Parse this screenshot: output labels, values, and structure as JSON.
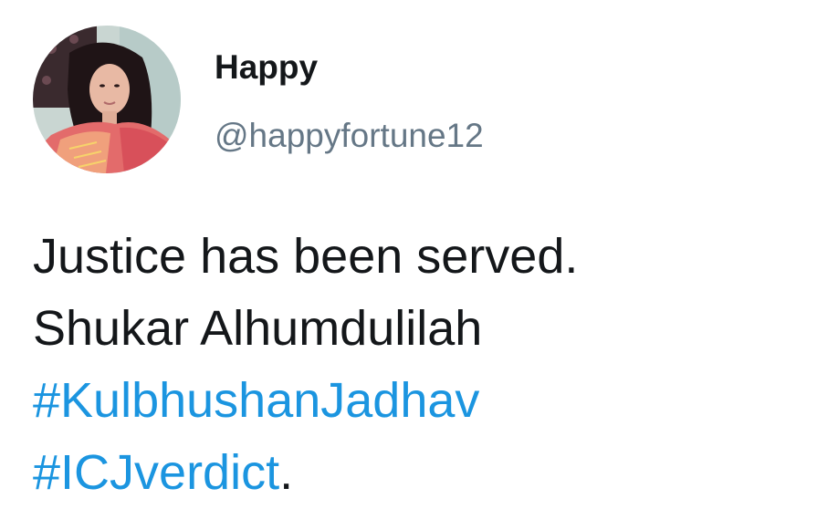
{
  "tweet": {
    "author": {
      "display_name": "Happy",
      "handle": "@happyfortune12"
    },
    "text": {
      "line1": "Justice has been served.",
      "line2": "Shukar Alhumdulilah",
      "hashtag1": "#KulbhushanJadhav",
      "hashtag2": "#ICJverdict",
      "trailing_punct": "."
    }
  },
  "colors": {
    "text_primary": "#14171a",
    "text_secondary": "#657786",
    "link": "#1b95e0",
    "background": "#ffffff"
  }
}
